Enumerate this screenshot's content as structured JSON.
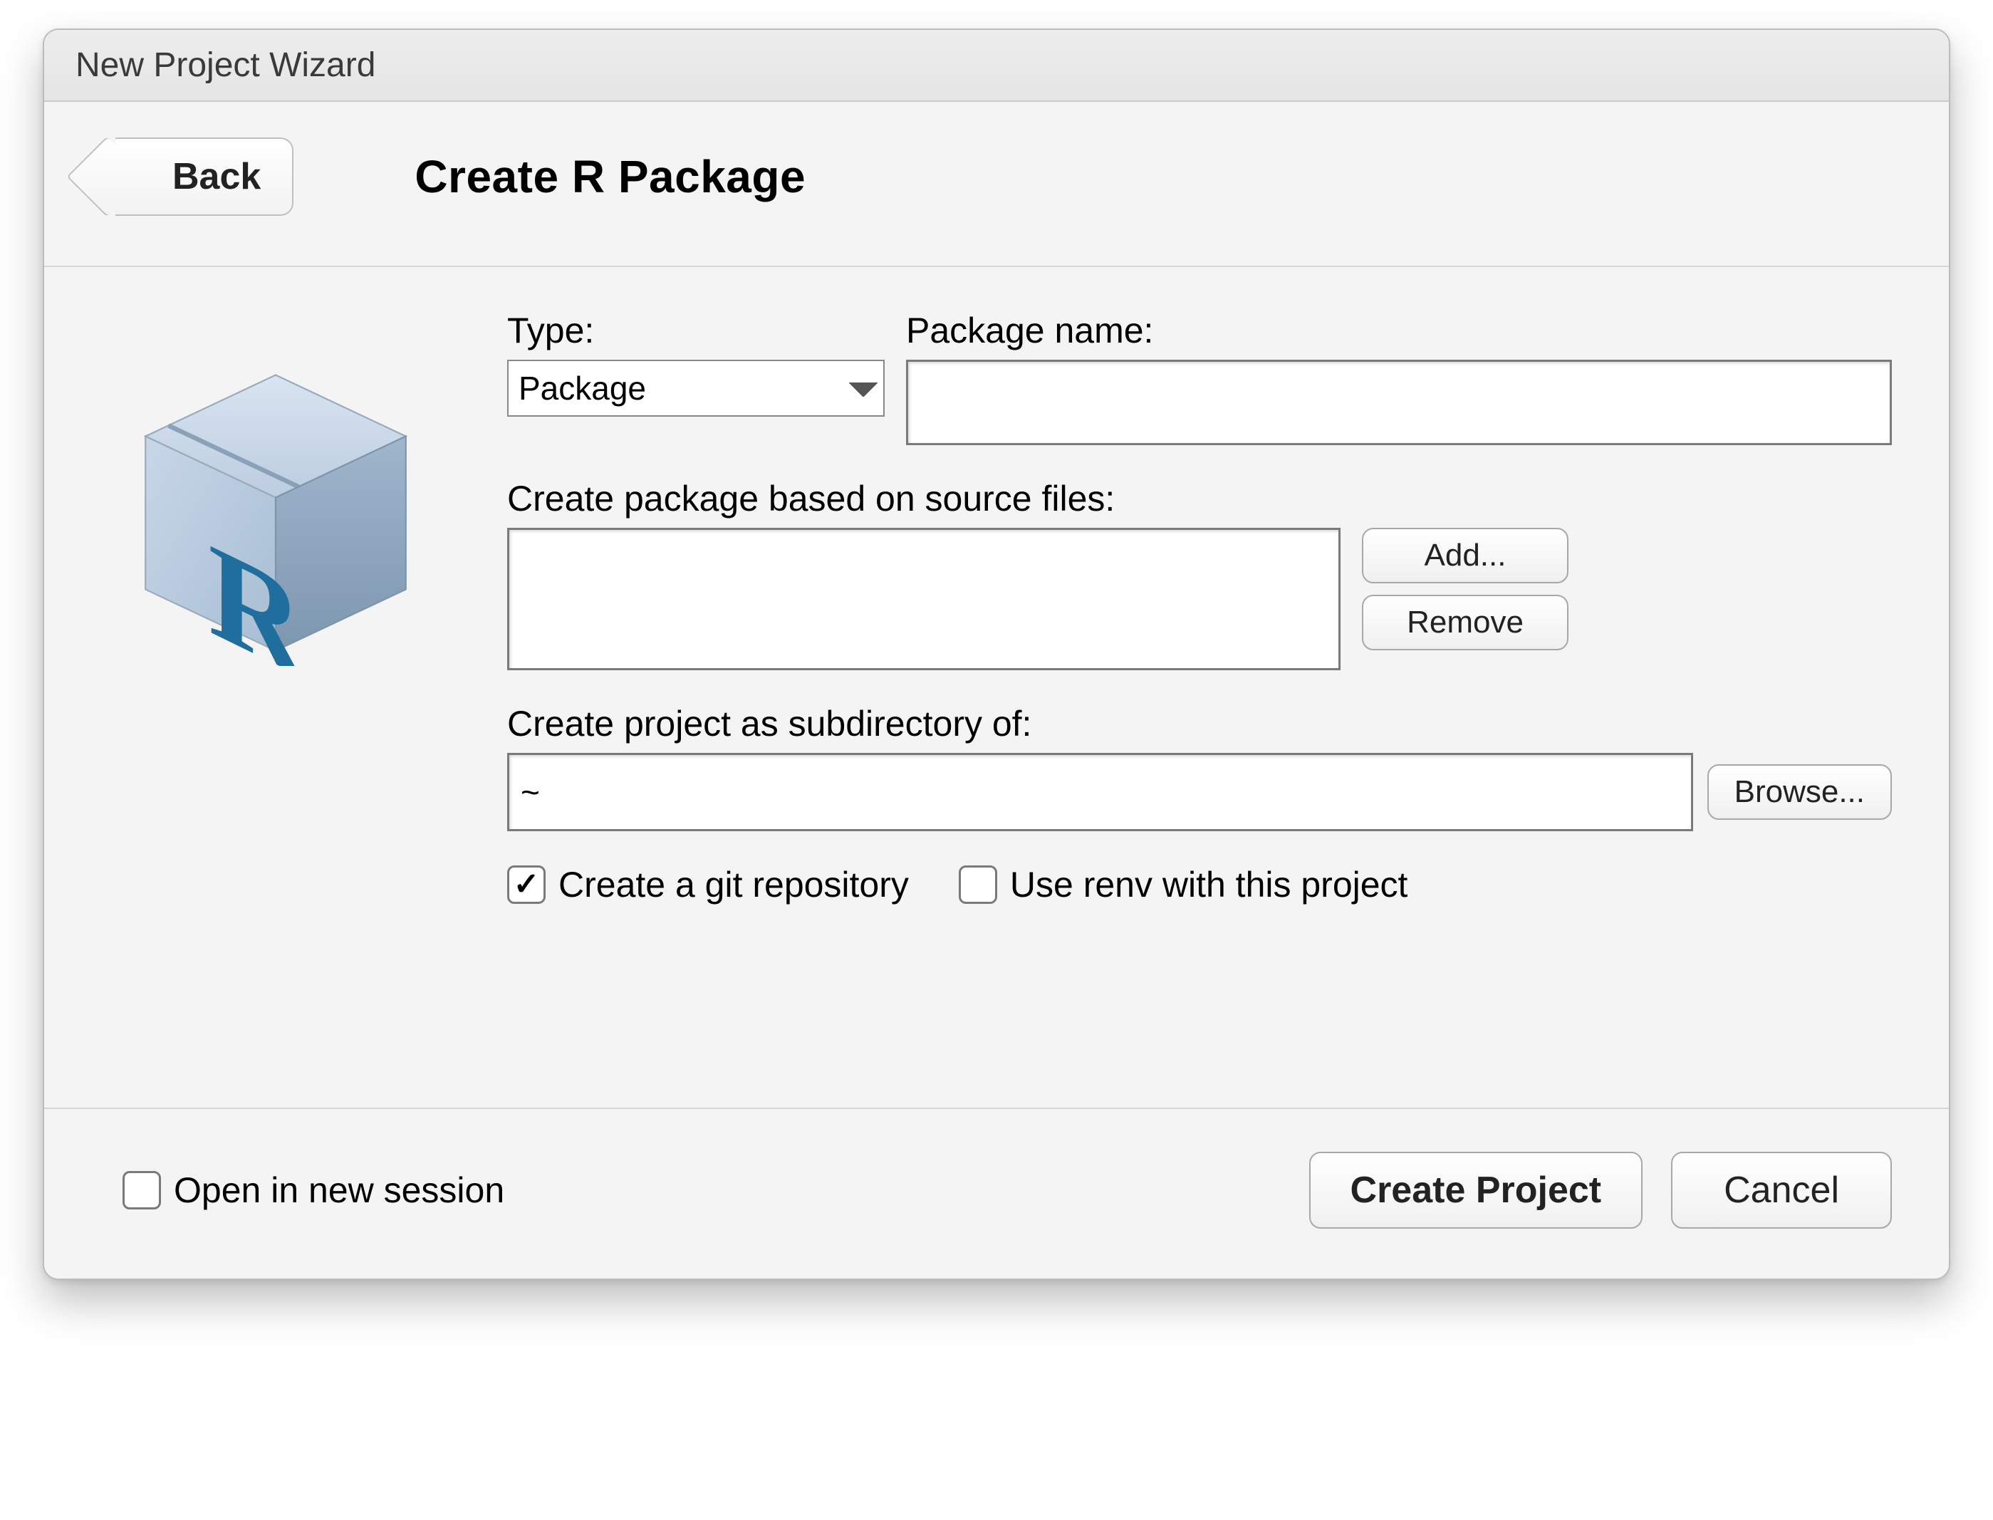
{
  "window": {
    "title": "New Project Wizard"
  },
  "header": {
    "back_label": "Back",
    "page_title": "Create R Package"
  },
  "form": {
    "type_label": "Type:",
    "type_value": "Package",
    "name_label": "Package name:",
    "name_value": "",
    "source_label": "Create package based on source files:",
    "add_label": "Add...",
    "remove_label": "Remove",
    "subdir_label": "Create project as subdirectory of:",
    "subdir_value": "~",
    "browse_label": "Browse...",
    "git_label": "Create a git repository",
    "git_checked": true,
    "renv_label": "Use renv with this project",
    "renv_checked": false
  },
  "footer": {
    "open_new_session_label": "Open in new session",
    "open_new_session_checked": false,
    "create_label": "Create Project",
    "cancel_label": "Cancel"
  },
  "icon": {
    "name": "r-package-box-icon"
  }
}
